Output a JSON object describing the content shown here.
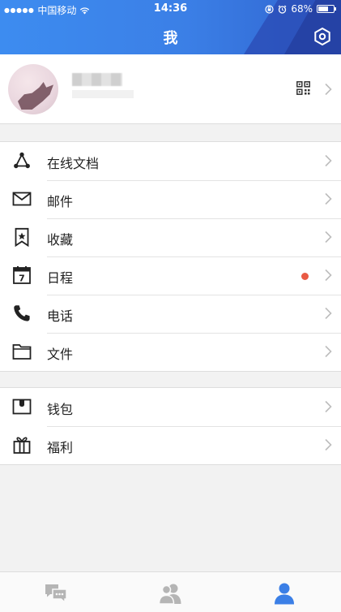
{
  "status_bar": {
    "signal_dots": "●●●●●",
    "carrier": "中国移动",
    "time": "14:36",
    "battery": "68%",
    "battery_level": 0.68
  },
  "header": {
    "title": "我"
  },
  "menu_group_1": [
    {
      "label": "在线文档",
      "icon": "share-nodes-icon"
    },
    {
      "label": "邮件",
      "icon": "mail-icon"
    },
    {
      "label": "收藏",
      "icon": "bookmark-star-icon"
    },
    {
      "label": "日程",
      "icon": "calendar-icon",
      "calendar_day": "7",
      "has_dot": true,
      "dot_color": "#e95a44"
    },
    {
      "label": "电话",
      "icon": "phone-icon"
    },
    {
      "label": "文件",
      "icon": "folder-icon"
    }
  ],
  "menu_group_2": [
    {
      "label": "钱包",
      "icon": "wallet-icon"
    },
    {
      "label": "福利",
      "icon": "gift-icon"
    }
  ],
  "tabbar": {
    "tabs": [
      {
        "icon": "chat-icon",
        "active": false
      },
      {
        "icon": "contacts-icon",
        "active": false
      },
      {
        "icon": "me-icon",
        "active": true
      }
    ],
    "active_color": "#3b7fe6",
    "inactive_color": "#b5b5b5"
  },
  "colors": {
    "header_start": "#3d8cf0",
    "header_end": "#2f63cf",
    "accent": "#3b7fe6"
  }
}
